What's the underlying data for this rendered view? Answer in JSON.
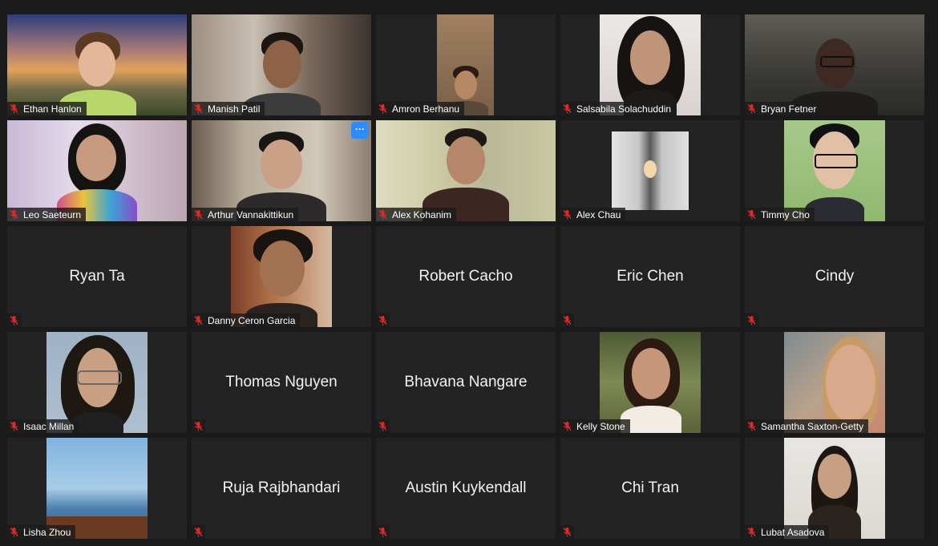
{
  "participants": [
    {
      "name": "Ethan Hanlon",
      "muted": true,
      "video": true
    },
    {
      "name": "Manish Patil",
      "muted": true,
      "video": true
    },
    {
      "name": "Amron Berhanu",
      "muted": true,
      "video": true
    },
    {
      "name": "Salsabila Solachuddin",
      "muted": true,
      "video": true
    },
    {
      "name": "Bryan Fetner",
      "muted": true,
      "video": true
    },
    {
      "name": "Leo Saeteurn",
      "muted": true,
      "video": true
    },
    {
      "name": "Arthur Vannakittikun",
      "muted": true,
      "video": true,
      "more_button": "···"
    },
    {
      "name": "Alex Kohanim",
      "muted": true,
      "video": true
    },
    {
      "name": "Alex Chau",
      "muted": true,
      "video": true
    },
    {
      "name": "Timmy Cho",
      "muted": true,
      "video": true
    },
    {
      "name": "Ryan Ta",
      "muted": true,
      "video": false
    },
    {
      "name": "Danny Ceron Garcia",
      "muted": true,
      "video": true
    },
    {
      "name": "Robert Cacho",
      "muted": true,
      "video": false
    },
    {
      "name": "Eric Chen",
      "muted": true,
      "video": false
    },
    {
      "name": "Cindy",
      "muted": true,
      "video": false
    },
    {
      "name": "Isaac Millan",
      "muted": true,
      "video": true
    },
    {
      "name": "Thomas Nguyen",
      "muted": true,
      "video": false
    },
    {
      "name": "Bhavana Nangare",
      "muted": true,
      "video": false
    },
    {
      "name": "Kelly Stone",
      "muted": true,
      "video": true
    },
    {
      "name": "Samantha Saxton-Getty",
      "muted": true,
      "video": true
    },
    {
      "name": "Lisha Zhou",
      "muted": true,
      "video": true
    },
    {
      "name": "Ruja Rajbhandari",
      "muted": true,
      "video": false
    },
    {
      "name": "Austin Kuykendall",
      "muted": true,
      "video": false
    },
    {
      "name": "Chi Tran",
      "muted": true,
      "video": false
    },
    {
      "name": "Lubat Asadova",
      "muted": true,
      "video": true
    }
  ],
  "icons": {
    "mute": "muted-microphone-icon",
    "more": "ellipsis-icon"
  },
  "colors": {
    "mute_icon": "#e02828",
    "more_button": "#2d8cff",
    "tile_bg": "#232323",
    "app_bg": "#1a1a1a"
  }
}
